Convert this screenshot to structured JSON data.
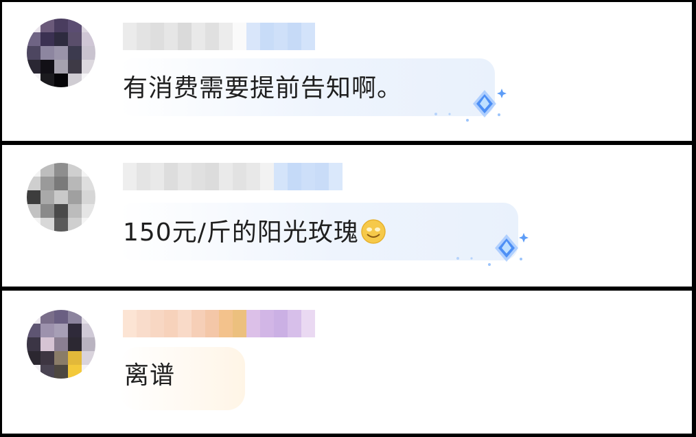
{
  "comments": [
    {
      "message": "有消费需要提前告知啊。",
      "has_badge": true,
      "badge_icon": "blue-diamond-sparkle-icon",
      "avatar_tones": [
        "#e8e2ea",
        "#6b5a7a",
        "#4a3d5f",
        "#5b4d72",
        "#dcd6e0",
        "#6f6484",
        "#3b3152",
        "#2e2b3f",
        "#5a4e6b",
        "#cfc6d5",
        "#4d4660",
        "#8d86a0",
        "#9a94aa",
        "#3c3a4e",
        "#c9c3cf",
        "#2a2733",
        "#121016",
        "#a6a2ae",
        "#3e3a46",
        "#dcd8de",
        "#f3f1f4",
        "#1b1a1e",
        "#060508",
        "#d0cdd3",
        "#f6f5f7"
      ]
    },
    {
      "message": "150元/斤的阳光玫瑰",
      "emoji_icon": "yellow-smile-emoji-icon",
      "has_badge": true,
      "badge_icon": "blue-diamond-sparkle-icon",
      "avatar_tones": [
        "#f2f2f2",
        "#bdbdbd",
        "#8e8e8e",
        "#cfcfcf",
        "#f4f4f4",
        "#cfcfcf",
        "#9a9a9a",
        "#7a7a7a",
        "#b8b8b8",
        "#dedede",
        "#3d3d3d",
        "#a9a9a9",
        "#c9c9c9",
        "#a0a0a0",
        "#d6d6d6",
        "#c2c2c2",
        "#8a8a8a",
        "#4a4a4a",
        "#bcbcbc",
        "#e5e5e5",
        "#f3f3f3",
        "#d8d8d8",
        "#5a5a5a",
        "#cfcfcf",
        "#f5f5f5"
      ]
    },
    {
      "message": "离谱",
      "has_badge": false,
      "avatar_tones": [
        "#ece8ee",
        "#7a6e8a",
        "#6a5f82",
        "#8c849e",
        "#e4e0e8",
        "#5e5572",
        "#9d92ad",
        "#a79fb6",
        "#2f2a3a",
        "#cfc9d6",
        "#3b3545",
        "#d6c4d4",
        "#8b7f92",
        "#2c2832",
        "#b9b3c0",
        "#2b2730",
        "#3e3642",
        "#8a7c68",
        "#e2b83a",
        "#d9d3dc",
        "#f1eff3",
        "#4a4452",
        "#4d4740",
        "#f3c93b",
        "#f5f3f6"
      ]
    }
  ],
  "name_blurs": [
    [
      "#ebebeb",
      "#e3e3e3",
      "#dedede",
      "#e6e6e6",
      "#dadada",
      "#e9e9e9",
      "#e0e0e0",
      "#ececec",
      "#fafafa",
      "#d9e6fa",
      "#c8dcf8",
      "#cfe0f9",
      "#c6daf7",
      "#d3e3fa"
    ],
    [
      "#eeeeee",
      "#e4e4e4",
      "#e9e9e9",
      "#dddddd",
      "#e6e6e6",
      "#e0e0e0",
      "#dcdcdc",
      "#eaeaea",
      "#e2e2e2",
      "#e8e8e8",
      "#f2f2f2",
      "#d4e4fa",
      "#c5daf8",
      "#cddff9",
      "#c9dcf8",
      "#dae8fb"
    ],
    [
      "#fce4d4",
      "#f9dccb",
      "#f8d7c3",
      "#f7d2bb",
      "#f9dac8",
      "#f6cfb7",
      "#f4c7a8",
      "#f3c28c",
      "#ecc07e",
      "#dcc0e8",
      "#d2b6e6",
      "#cbb0e4",
      "#d7bfea",
      "#ead9f2"
    ]
  ]
}
